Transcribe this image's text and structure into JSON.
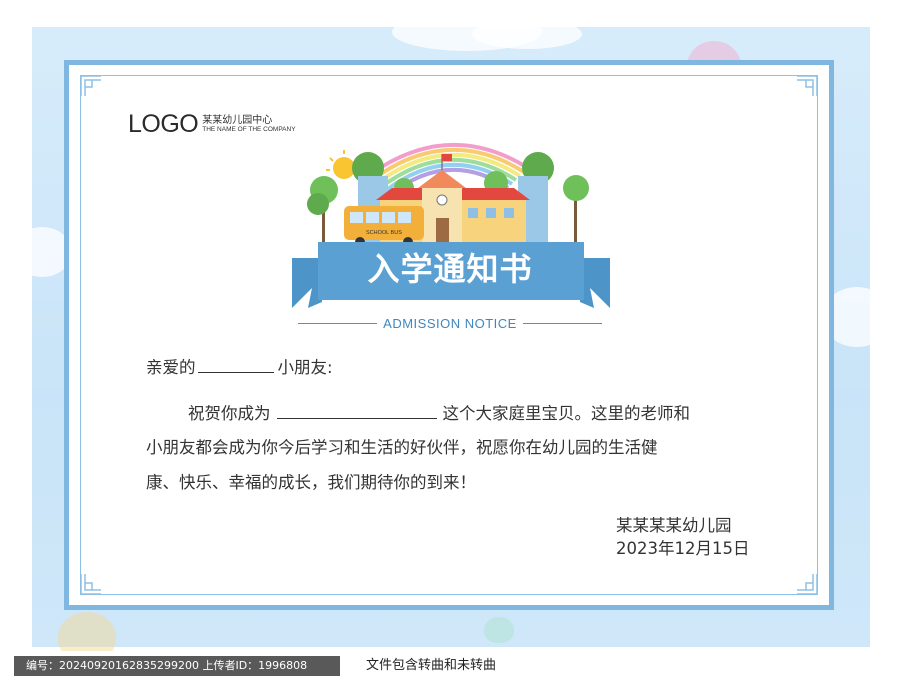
{
  "logo": {
    "main": "LOGO",
    "cn": "某某幼儿园中心",
    "en": "THE NAME OF THE COMPANY"
  },
  "illustration": {
    "bus_text": "SCHOOL BUS"
  },
  "title": "入学通知书",
  "subtitle": "ADMISSION NOTICE",
  "greeting": {
    "prefix": "亲爱的",
    "suffix": "小朋友:"
  },
  "body": {
    "line1_prefix": "祝贺你成为",
    "line1_suffix": "这个大家庭里宝贝。这里的老师和",
    "line2": "小朋友都会成为你今后学习和生活的好伙伴，祝愿你在幼儿园的生活健",
    "line3": "康、快乐、幸福的成长，我们期待你的到来！"
  },
  "signature": {
    "org": "某某某某幼儿园",
    "date": "2023年12月15日"
  },
  "footer": {
    "meta": "编号：20240920162835299200   上传者ID：1996808",
    "note": "文件包含转曲和未转曲"
  },
  "colors": {
    "frame": "#7fb7e1",
    "banner": "#4d94c9",
    "background": "#d7ecfb"
  }
}
